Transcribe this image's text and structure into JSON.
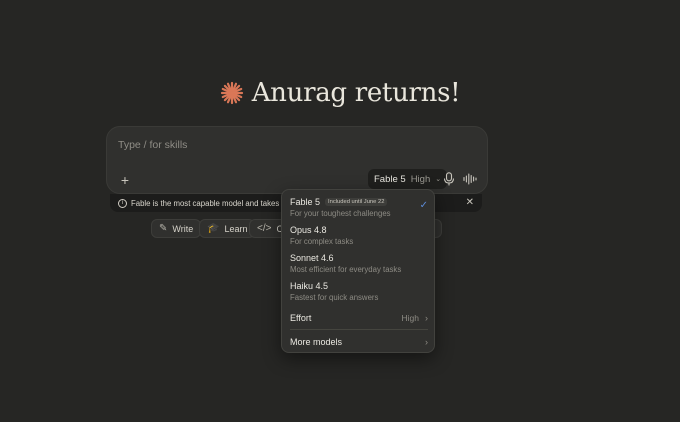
{
  "greeting": {
    "text": "Anurag returns!"
  },
  "composer": {
    "placeholder": "Type / for skills",
    "model_name": "Fable 5",
    "model_effort": "High"
  },
  "banner": {
    "message": "Fable is the most capable model and takes 2× th"
  },
  "chips": [
    {
      "label": "Write"
    },
    {
      "label": "Learn"
    },
    {
      "label": "Cod"
    }
  ],
  "dropdown": {
    "models": [
      {
        "name": "Fable 5",
        "badge": "Included until June 22",
        "description": "For your toughest challenges",
        "selected": true
      },
      {
        "name": "Opus 4.8",
        "description": "For complex tasks"
      },
      {
        "name": "Sonnet 4.6",
        "description": "Most efficient for everyday tasks"
      },
      {
        "name": "Haiku 4.5",
        "description": "Fastest for quick answers"
      }
    ],
    "effort_label": "Effort",
    "effort_value": "High",
    "more_models": "More models"
  },
  "colors": {
    "accent_spark": "#d97757",
    "check": "#5d8cd8",
    "background": "#262624"
  },
  "icons": [
    "spark-icon",
    "plus-icon",
    "chevron-down-icon",
    "mic-icon",
    "waveform-icon",
    "info-icon",
    "close-icon",
    "pencil-icon",
    "graduation-cap-icon",
    "code-icon",
    "check-icon",
    "chevron-right-icon"
  ]
}
